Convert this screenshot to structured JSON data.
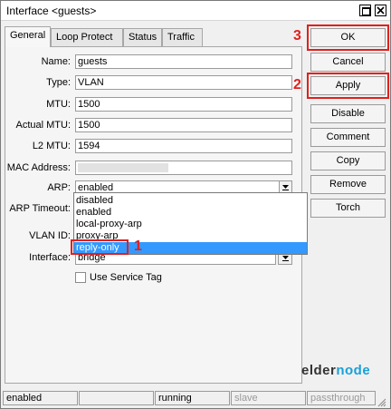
{
  "window": {
    "title": "Interface <guests>"
  },
  "tabs": [
    "General",
    "Loop Protect",
    "Status",
    "Traffic"
  ],
  "form": {
    "name": {
      "label": "Name:",
      "value": "guests"
    },
    "type": {
      "label": "Type:",
      "value": "VLAN"
    },
    "mtu": {
      "label": "MTU:",
      "value": "1500"
    },
    "actual_mtu": {
      "label": "Actual MTU:",
      "value": "1500"
    },
    "l2_mtu": {
      "label": "L2 MTU:",
      "value": "1594"
    },
    "mac_address": {
      "label": "MAC Address:",
      "value": ""
    },
    "arp": {
      "label": "ARP:",
      "value": "enabled"
    },
    "arp_timeout": {
      "label": "ARP Timeout:"
    },
    "vlan_id": {
      "label": "VLAN ID:"
    },
    "interface": {
      "label": "Interface:",
      "value": "bridge"
    },
    "use_service_tag": {
      "label": "Use Service Tag",
      "checked": false
    }
  },
  "arp_options": [
    "disabled",
    "enabled",
    "local-proxy-arp",
    "proxy-arp",
    "reply-only"
  ],
  "arp_selected_option": "reply-only",
  "buttons": [
    "OK",
    "Cancel",
    "Apply",
    "Disable",
    "Comment",
    "Copy",
    "Remove",
    "Torch"
  ],
  "annotations": {
    "step1": "1",
    "step2": "2",
    "step3": "3",
    "color": "#e0201e"
  },
  "status_bar": [
    "enabled",
    "",
    "running",
    "slave",
    "passthrough"
  ],
  "watermark": {
    "text_dark": "elder",
    "text_accent": "node",
    "accent_color": "#1aa0d8"
  },
  "icons": {
    "maximize": "maximize-icon",
    "close": "close-icon",
    "dropdown": "dropdown-arrow-icon",
    "resize": "resize-grip-icon"
  }
}
